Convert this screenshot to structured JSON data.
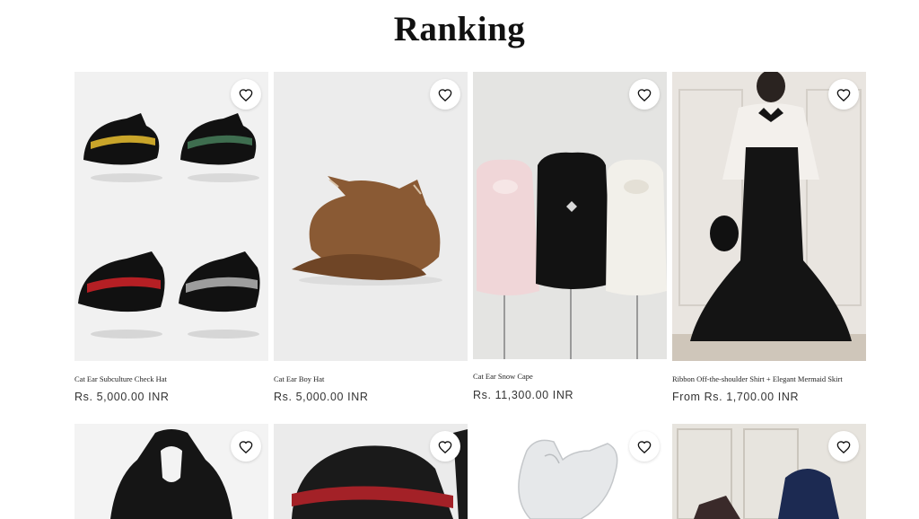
{
  "page": {
    "title": "Ranking"
  },
  "products": [
    {
      "name": "Cat Ear Subculture Check Hat",
      "price": "Rs. 5,000.00 INR",
      "wishlist_icon": "heart-outline-icon"
    },
    {
      "name": "Cat Ear Boy Hat",
      "price": "Rs. 5,000.00 INR",
      "wishlist_icon": "heart-outline-icon"
    },
    {
      "name": "Cat Ear Snow Cape",
      "price": "Rs. 11,300.00 INR",
      "wishlist_icon": "heart-outline-icon"
    },
    {
      "name": "Ribbon Off-the-shoulder Shirt + Elegant Mermaid Skirt",
      "price": "From Rs. 1,700.00 INR",
      "wishlist_icon": "heart-outline-icon"
    },
    {
      "name": "",
      "price": "",
      "wishlist_icon": "heart-outline-icon"
    },
    {
      "name": "",
      "price": "",
      "wishlist_icon": "heart-outline-icon"
    },
    {
      "name": "",
      "price": "",
      "wishlist_icon": "heart-outline-icon"
    },
    {
      "name": "",
      "price": "",
      "wishlist_icon": "heart-outline-icon"
    }
  ]
}
